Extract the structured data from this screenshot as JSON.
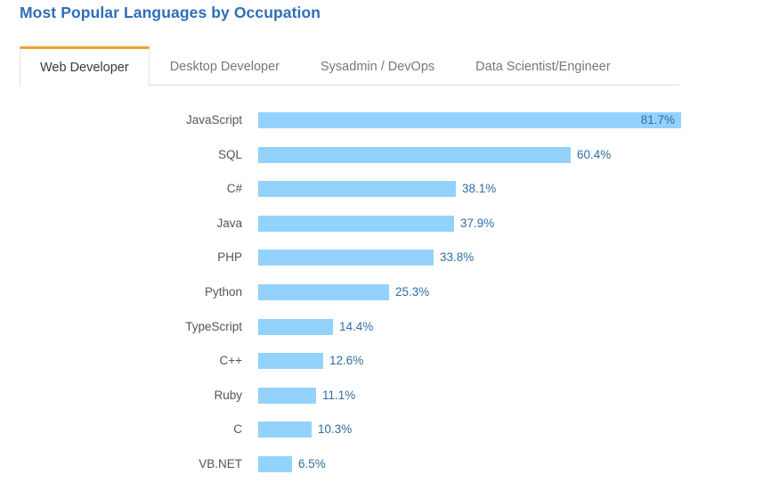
{
  "header": {
    "title": "Most Popular Languages by Occupation",
    "title_color": "#2e6fb7"
  },
  "tabs": {
    "active_index": 0,
    "active_indicator_color": "#f0a22e",
    "items": [
      {
        "label": "Web Developer"
      },
      {
        "label": "Desktop Developer"
      },
      {
        "label": "Sysadmin / DevOps"
      },
      {
        "label": "Data Scientist/Engineer"
      }
    ]
  },
  "chart_data": {
    "type": "bar",
    "orientation": "horizontal",
    "title": "Most Popular Languages by Occupation",
    "subtitle": "Web Developer",
    "xlabel": "",
    "ylabel": "",
    "xlim": [
      0,
      81.7
    ],
    "grid": false,
    "legend": null,
    "bar_color": "#93d3fb",
    "value_label_color": "#2f6da3",
    "value_suffix": "%",
    "categories": [
      "JavaScript",
      "SQL",
      "C#",
      "Java",
      "PHP",
      "Python",
      "TypeScript",
      "C++",
      "Ruby",
      "C",
      "VB.NET"
    ],
    "values": [
      81.7,
      60.4,
      38.1,
      37.9,
      33.8,
      25.3,
      14.4,
      12.6,
      11.1,
      10.3,
      6.5
    ],
    "value_labels": [
      "81.7%",
      "60.4%",
      "38.1%",
      "37.9%",
      "33.8%",
      "25.3%",
      "14.4%",
      "12.6%",
      "11.1%",
      "10.3%",
      "6.5%"
    ],
    "label_placement": [
      "inside",
      "outside",
      "outside",
      "outside",
      "outside",
      "outside",
      "outside",
      "outside",
      "outside",
      "outside",
      "outside"
    ]
  }
}
